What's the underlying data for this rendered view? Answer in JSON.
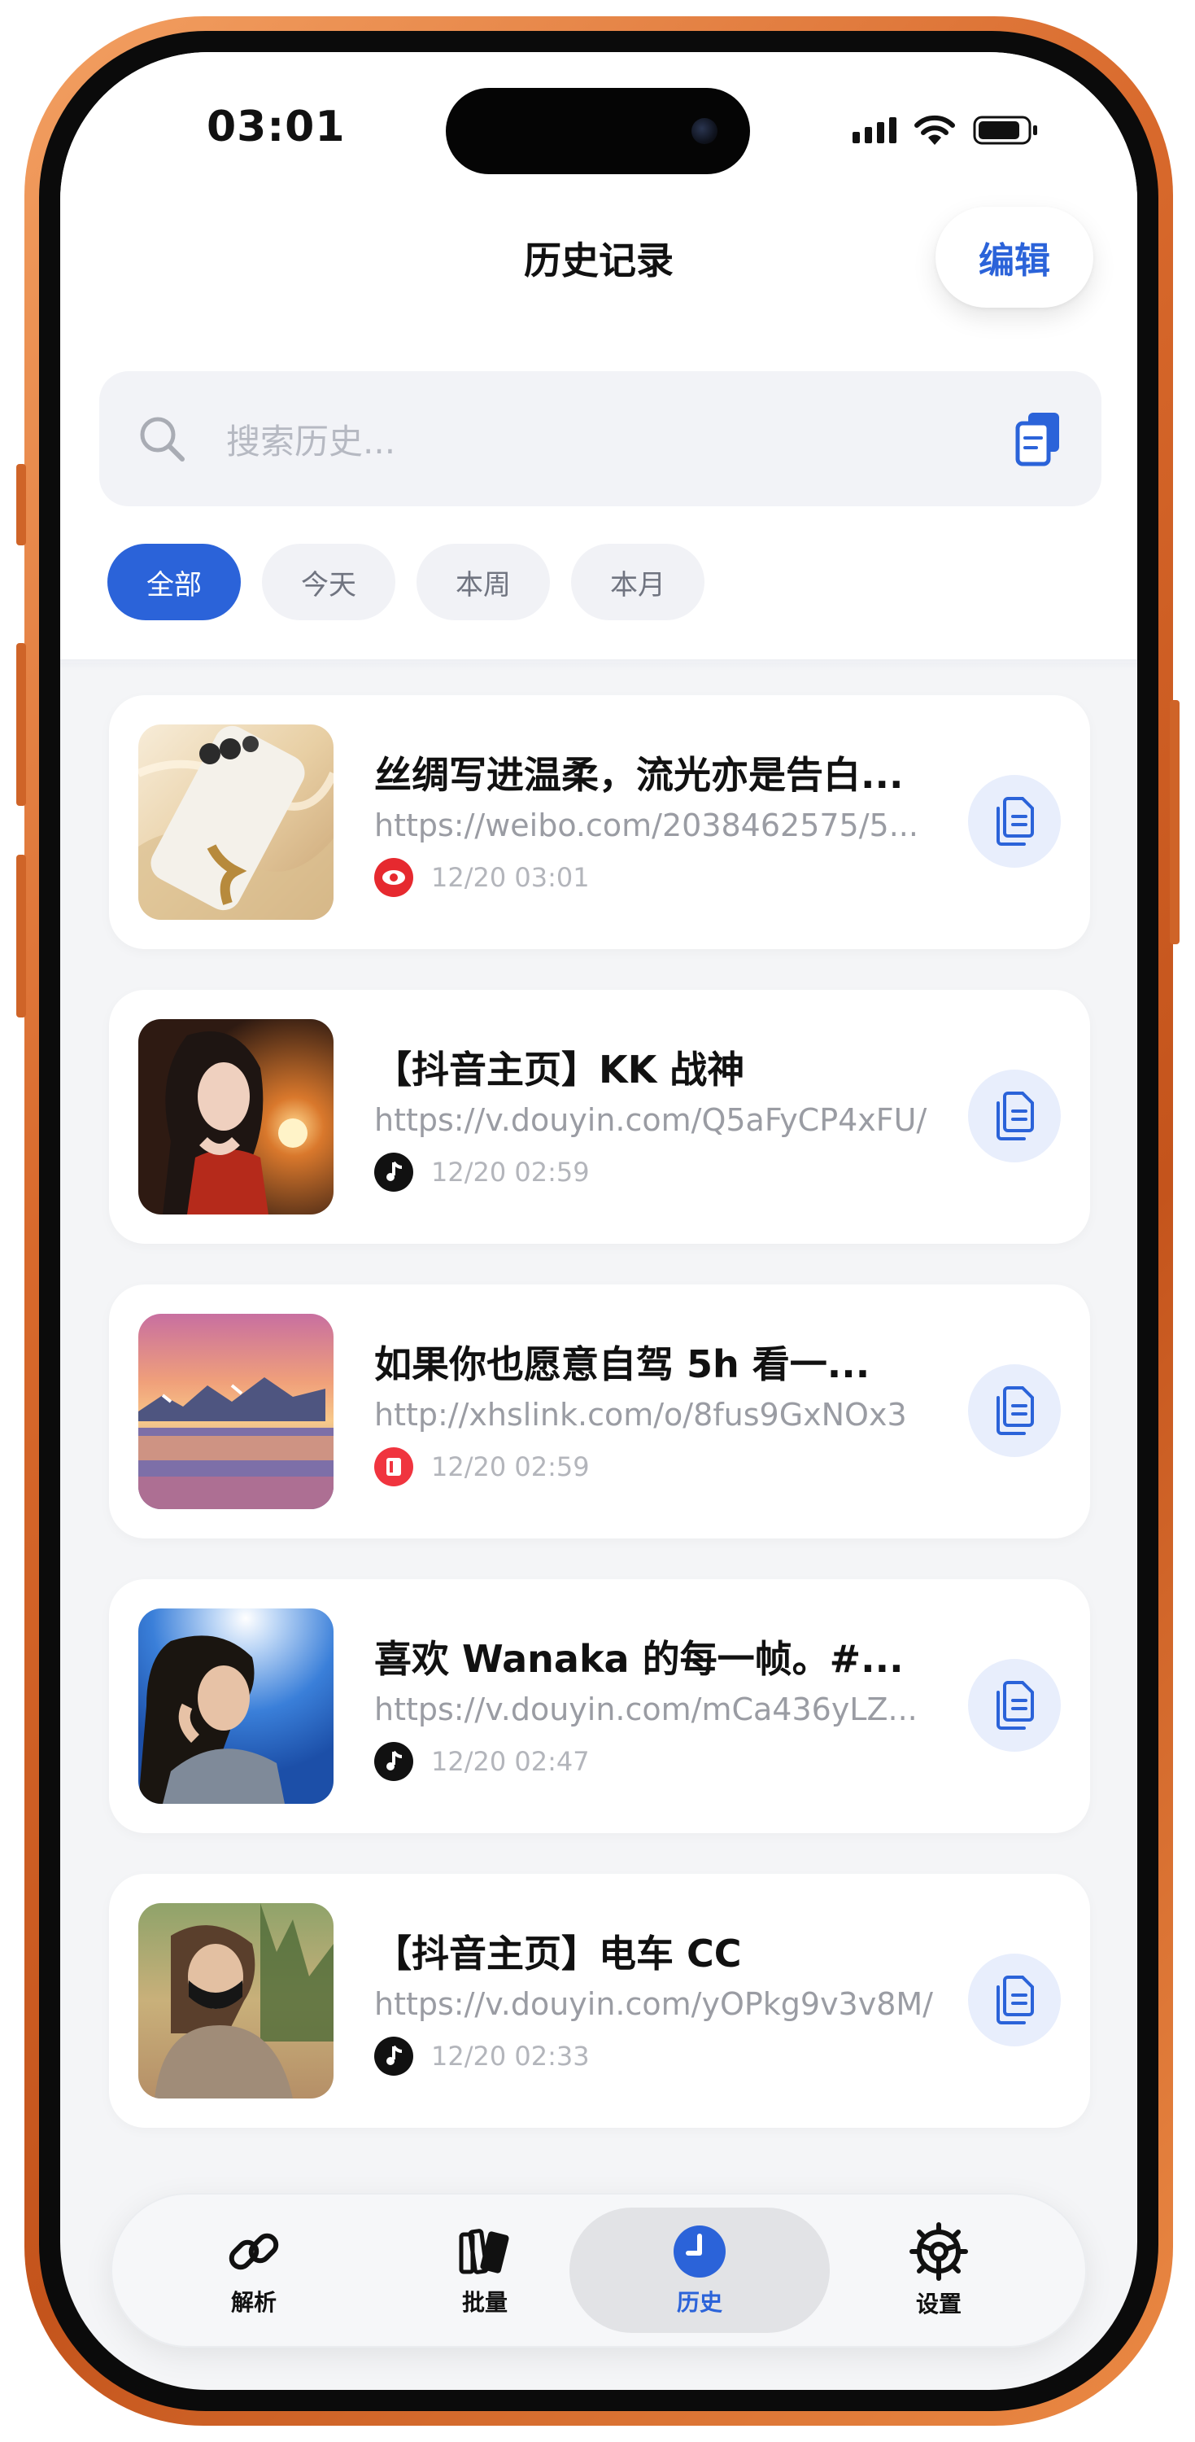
{
  "status_bar": {
    "time": "03:01"
  },
  "header": {
    "title": "历史记录",
    "edit_label": "编辑"
  },
  "search": {
    "placeholder": "搜索历史..."
  },
  "filters": [
    {
      "label": "全部",
      "active": true
    },
    {
      "label": "今天",
      "active": false
    },
    {
      "label": "本周",
      "active": false
    },
    {
      "label": "本月",
      "active": false
    }
  ],
  "history": [
    {
      "title": "丝绸写进温柔，流光亦是告白...",
      "url": "https://weibo.com/2038462575/5...",
      "time": "12/20 03:01",
      "source_icon": "weibo-eye-icon",
      "source_color": "#e6292f"
    },
    {
      "title": "【抖音主页】KK 战神",
      "url": "https://v.douyin.com/Q5aFyCP4xFU/",
      "time": "12/20 02:59",
      "source_icon": "douyin-music-icon",
      "source_color": "#111111"
    },
    {
      "title": "如果你也愿意自驾 5h 看一...",
      "url": "http://xhslink.com/o/8fus9GxNOx3",
      "time": "12/20 02:59",
      "source_icon": "xiaohongshu-book-icon",
      "source_color": "#f0343f"
    },
    {
      "title": "喜欢 Wanaka 的每一帧。#...",
      "url": "https://v.douyin.com/mCa436yLZ...",
      "time": "12/20 02:47",
      "source_icon": "douyin-music-icon",
      "source_color": "#111111"
    },
    {
      "title": "【抖音主页】电车 CC",
      "url": "https://v.douyin.com/yOPkg9v3v8M/",
      "time": "12/20 02:33",
      "source_icon": "douyin-music-icon",
      "source_color": "#111111"
    }
  ],
  "tabs": [
    {
      "label": "解析",
      "icon": "link-icon",
      "active": false
    },
    {
      "label": "批量",
      "icon": "stack-icon",
      "active": false
    },
    {
      "label": "历史",
      "icon": "clock-icon",
      "active": true
    },
    {
      "label": "设置",
      "icon": "gear-icon",
      "active": false
    }
  ],
  "colors": {
    "accent": "#2b63d9",
    "frame": "#d8692c",
    "copy_bg": "#e8eefc"
  }
}
